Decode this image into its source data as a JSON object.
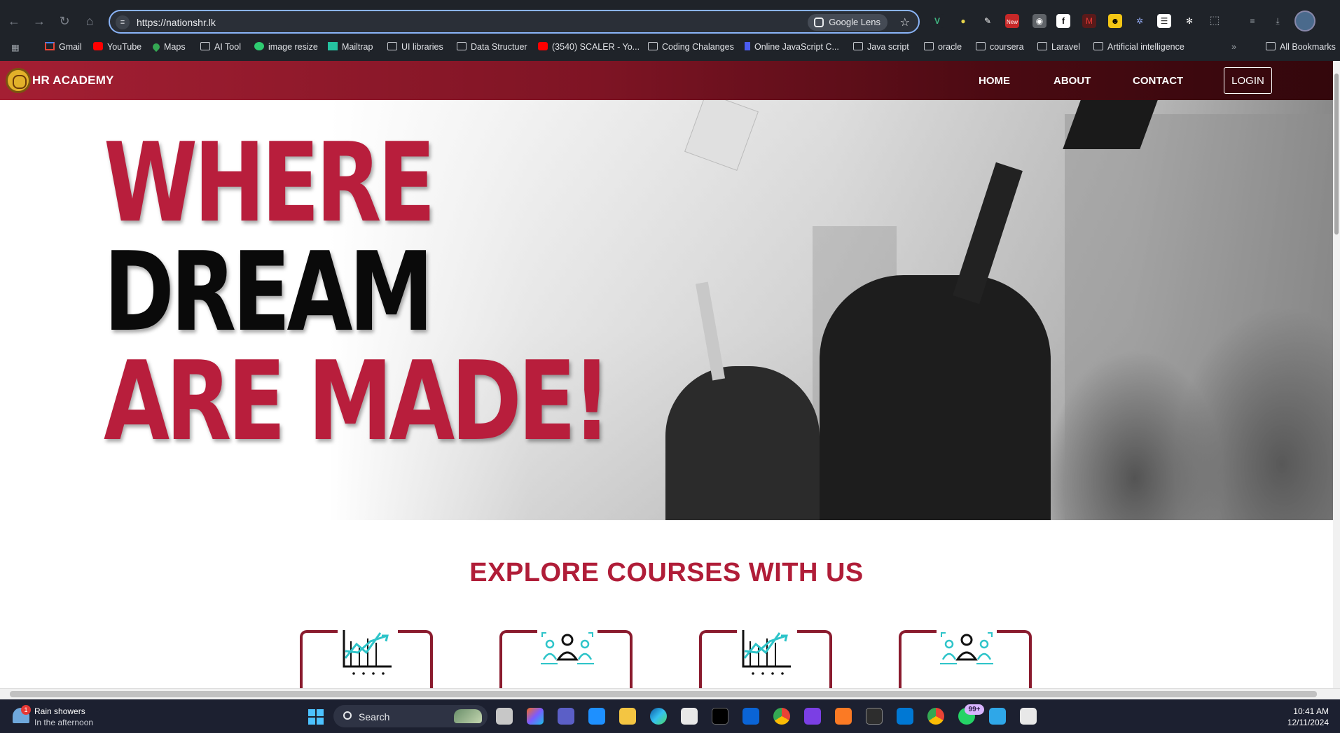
{
  "browser": {
    "url": "https://nationshr.lk",
    "lens_label": "Google Lens",
    "extensions": [
      "vue-devtools-icon",
      "bulb-icon",
      "pen-icon",
      "new-badge-extension-icon",
      "camera-icon",
      "f-extension-icon",
      "m-extension-icon",
      "face-extension-icon",
      "gear-extension-icon",
      "list-extension-icon",
      "react-icon",
      "puzzle-icon"
    ],
    "new_badge": "New",
    "bookmarks": [
      {
        "label": "Gmail",
        "icon": "gmail-icon"
      },
      {
        "label": "YouTube",
        "icon": "youtube-icon"
      },
      {
        "label": "Maps",
        "icon": "maps-icon"
      },
      {
        "label": "AI Tool",
        "icon": "folder-icon"
      },
      {
        "label": "image resize",
        "icon": "circle-icon"
      },
      {
        "label": "Mailtrap",
        "icon": "mailtrap-icon"
      },
      {
        "label": "UI libraries",
        "icon": "folder-icon"
      },
      {
        "label": "Data Structuer",
        "icon": "folder-icon"
      },
      {
        "label": "(3540) SCALER - Yo...",
        "icon": "youtube-icon"
      },
      {
        "label": "Coding Chalanges",
        "icon": "folder-icon"
      },
      {
        "label": "Online JavaScript C...",
        "icon": "js-icon"
      },
      {
        "label": "Java script",
        "icon": "folder-icon"
      },
      {
        "label": "oracle",
        "icon": "folder-icon"
      },
      {
        "label": "coursera",
        "icon": "folder-icon"
      },
      {
        "label": "Laravel",
        "icon": "folder-icon"
      },
      {
        "label": "Artificial intelligence",
        "icon": "folder-icon"
      }
    ],
    "all_bookmarks": "All Bookmarks",
    "overflow": "»"
  },
  "site": {
    "brand": "HR ACADEMY",
    "nav": {
      "home": "HOME",
      "about": "ABOUT",
      "contact": "CONTACT",
      "login": "LOGIN"
    },
    "hero": {
      "line1": "WHERE",
      "line2": "DREAM",
      "line3": "ARE MADE!"
    },
    "explore_title": "EXPLORE COURSES WITH US",
    "courses": [
      {
        "icon": "growth-chart-icon"
      },
      {
        "icon": "team-people-icon"
      },
      {
        "icon": "growth-chart-icon"
      },
      {
        "icon": "team-people-icon"
      }
    ],
    "colors": {
      "brand_red": "#b81e3c",
      "header_dark": "#33070c",
      "card_border": "#8a1b2e",
      "icon_teal": "#2ec4c9"
    }
  },
  "taskbar": {
    "weather_title": "Rain showers",
    "weather_sub": "In the afternoon",
    "weather_badge": "1",
    "search_label": "Search",
    "whatsapp_badge": "99+",
    "time": "10:41 AM",
    "date": "12/11/2024"
  }
}
